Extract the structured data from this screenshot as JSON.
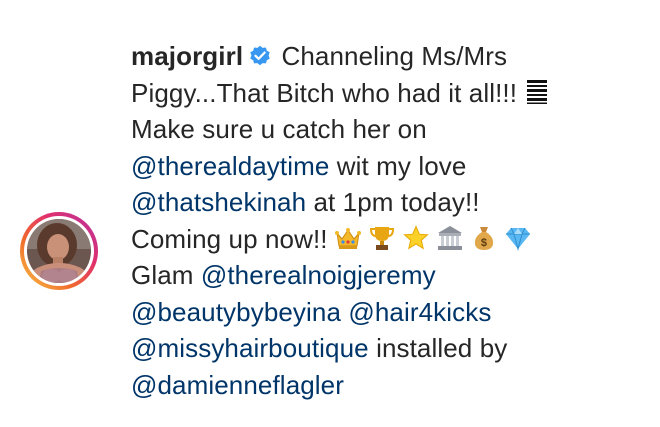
{
  "post": {
    "avatar_icon": "profile-avatar",
    "username": "majorgirl",
    "verified_icon": "verified-badge-icon",
    "lines": [
      {
        "text": " Channeling Ms/Mrs"
      },
      {
        "text": "Piggy...That Bitch who had it all!!! "
      },
      {
        "text": "Make sure u catch her on"
      },
      {
        "mention": "@therealdaytime",
        "text": " wit my love"
      },
      {
        "mention": "@thatshekinah",
        "text": " at 1pm today!!"
      },
      {
        "text": "Coming up now!! "
      },
      {
        "text": "Glam ",
        "mention": "@therealnoigjeremy"
      },
      {
        "mention": "@beautybybeyina",
        "mention2": "@hair4kicks"
      },
      {
        "mention": "@missyhairboutique",
        "text": " installed by"
      },
      {
        "mention": "@damienneflagler"
      }
    ],
    "emojis": [
      "barcode-emoji",
      "crown-emoji",
      "trophy-emoji",
      "star-emoji",
      "bank-emoji",
      "money-bag-emoji",
      "diamond-emoji"
    ],
    "colors": {
      "text": "#262626",
      "mention": "#003569",
      "verified": "#3897f0"
    }
  }
}
